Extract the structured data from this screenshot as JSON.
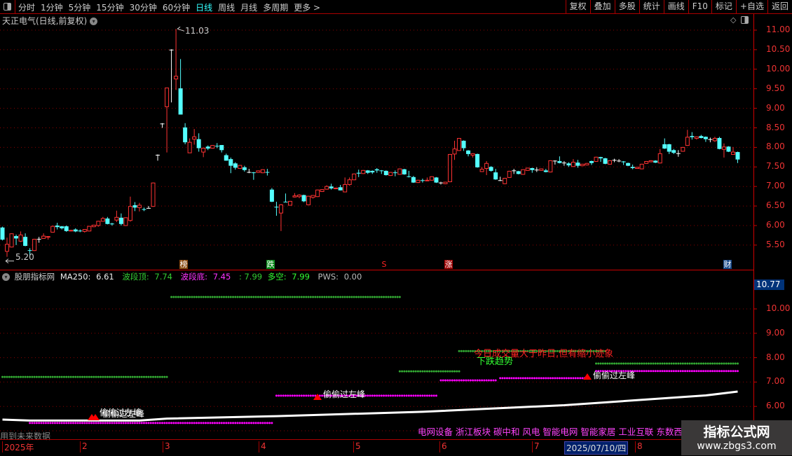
{
  "toolbar": {
    "periods": [
      "分时",
      "1分钟",
      "5分钟",
      "15分钟",
      "30分钟",
      "60分钟",
      "日线",
      "周线",
      "月线",
      "多周期",
      "更多 >"
    ],
    "active_period": "日线",
    "tools": [
      "复权",
      "叠加",
      "多股",
      "统计",
      "画线",
      "F10",
      "标记",
      "+自选",
      "返回"
    ]
  },
  "chart": {
    "title": "天正电气(日线,前复权)",
    "high_label": "11.03",
    "low_label": "5.20",
    "price_axis": [
      "11.00",
      "10.50",
      "10.00",
      "9.50",
      "9.00",
      "8.50",
      "8.00",
      "7.50",
      "7.00",
      "6.50",
      "6.00",
      "5.50"
    ],
    "colors": {
      "up": "#ff3333",
      "down": "#54ffff",
      "flat": "#ffffff",
      "grid": "#8b0000"
    },
    "tags": [
      {
        "text": "榜",
        "color": "#8a4a10"
      },
      {
        "text": "跌",
        "color": "#0a8a1a"
      },
      {
        "text": "S",
        "color": "#000000"
      },
      {
        "text": "涨",
        "color": "#a00000"
      },
      {
        "text": "财",
        "color": "#1a4a8a"
      }
    ],
    "candles": [
      [
        5.95,
        5.97,
        5.62,
        5.64
      ],
      [
        5.34,
        5.69,
        5.2,
        5.52
      ],
      [
        5.45,
        5.8,
        5.44,
        5.79
      ],
      [
        5.73,
        5.77,
        5.5,
        5.67
      ],
      [
        5.6,
        5.85,
        5.58,
        5.76
      ],
      [
        5.71,
        5.8,
        5.47,
        5.48
      ],
      [
        5.37,
        5.42,
        5.24,
        5.36
      ],
      [
        5.36,
        5.66,
        5.35,
        5.65
      ],
      [
        5.66,
        5.71,
        5.56,
        5.66
      ],
      [
        5.67,
        5.8,
        5.66,
        5.73
      ],
      [
        5.7,
        5.73,
        5.64,
        5.72
      ],
      [
        5.83,
        6.0,
        5.82,
        5.98
      ],
      [
        6.0,
        6.07,
        5.9,
        5.96
      ],
      [
        5.98,
        5.99,
        5.9,
        5.93
      ],
      [
        5.98,
        6.0,
        5.84,
        5.86
      ],
      [
        5.86,
        5.88,
        5.85,
        5.88
      ],
      [
        5.9,
        5.93,
        5.83,
        5.85
      ],
      [
        5.87,
        5.9,
        5.83,
        5.86
      ],
      [
        5.85,
        5.91,
        5.82,
        5.9
      ],
      [
        5.86,
        5.99,
        5.85,
        5.98
      ],
      [
        5.97,
        6.02,
        5.96,
        6.01
      ],
      [
        6.0,
        6.12,
        5.97,
        6.11
      ],
      [
        6.11,
        6.22,
        6.1,
        6.18
      ],
      [
        6.18,
        6.22,
        6.03,
        6.04
      ],
      [
        6.05,
        6.07,
        6.0,
        6.04
      ],
      [
        6.14,
        6.38,
        6.09,
        6.21
      ],
      [
        6.2,
        6.31,
        6.0,
        6.04
      ],
      [
        6.0,
        6.21,
        5.99,
        6.2
      ],
      [
        6.13,
        6.74,
        6.1,
        6.49
      ],
      [
        6.52,
        6.6,
        6.37,
        6.46
      ],
      [
        6.46,
        6.58,
        6.36,
        6.52
      ],
      [
        6.42,
        6.46,
        6.37,
        6.41
      ],
      [
        6.45,
        6.5,
        6.44,
        6.45
      ],
      [
        6.49,
        7.1,
        6.48,
        7.09
      ],
      [
        7.81,
        7.82,
        7.66,
        7.81
      ],
      [
        8.61,
        8.62,
        8.5,
        8.61
      ],
      [
        9.04,
        9.52,
        7.87,
        9.52
      ],
      [
        10.5,
        10.51,
        9.15,
        10.5
      ],
      [
        9.75,
        11.03,
        9.47,
        9.82
      ],
      [
        9.51,
        10.26,
        8.84,
        8.84
      ],
      [
        8.51,
        8.62,
        8.08,
        8.13
      ],
      [
        7.86,
        8.23,
        7.86,
        8.13
      ],
      [
        8.21,
        8.47,
        8.07,
        8.27
      ],
      [
        8.21,
        8.36,
        7.89,
        7.98
      ],
      [
        7.88,
        7.98,
        7.75,
        7.98
      ],
      [
        8.02,
        8.05,
        7.93,
        7.97
      ],
      [
        7.98,
        8.06,
        7.97,
        8.05
      ],
      [
        8.04,
        8.11,
        7.98,
        8.03
      ],
      [
        8.06,
        8.06,
        7.87,
        7.93
      ],
      [
        7.8,
        7.84,
        7.66,
        7.66
      ],
      [
        7.7,
        7.74,
        7.34,
        7.53
      ],
      [
        7.59,
        7.62,
        7.43,
        7.48
      ],
      [
        7.46,
        7.55,
        7.45,
        7.54
      ],
      [
        7.49,
        7.53,
        7.38,
        7.42
      ],
      [
        7.37,
        7.45,
        7.34,
        7.37
      ],
      [
        7.36,
        7.37,
        7.17,
        7.35
      ],
      [
        7.36,
        7.41,
        7.35,
        7.4
      ],
      [
        7.35,
        7.44,
        7.34,
        7.43
      ],
      [
        7.37,
        7.45,
        7.28,
        7.36
      ],
      [
        6.92,
        6.96,
        6.6,
        6.61
      ],
      [
        6.48,
        6.61,
        6.25,
        6.47
      ],
      [
        6.32,
        6.55,
        5.86,
        6.53
      ],
      [
        6.61,
        6.82,
        6.6,
        6.6
      ],
      [
        6.52,
        6.63,
        6.51,
        6.62
      ],
      [
        6.73,
        6.83,
        6.72,
        6.76
      ],
      [
        6.74,
        6.8,
        6.7,
        6.78
      ],
      [
        6.78,
        6.79,
        6.6,
        6.62
      ],
      [
        6.53,
        6.76,
        6.52,
        6.75
      ],
      [
        6.72,
        6.78,
        6.69,
        6.77
      ],
      [
        6.74,
        6.92,
        6.73,
        6.91
      ],
      [
        6.87,
        6.93,
        6.86,
        6.92
      ],
      [
        6.93,
        7.03,
        6.92,
        7.0
      ],
      [
        7.0,
        7.07,
        6.92,
        6.95
      ],
      [
        6.94,
        6.97,
        6.93,
        6.96
      ],
      [
        6.98,
        7.04,
        6.9,
        6.9
      ],
      [
        6.86,
        7.23,
        6.85,
        7.05
      ],
      [
        7.05,
        7.23,
        7.02,
        7.17
      ],
      [
        7.17,
        7.33,
        7.16,
        7.32
      ],
      [
        7.35,
        7.43,
        7.24,
        7.33
      ],
      [
        7.33,
        7.42,
        7.32,
        7.41
      ],
      [
        7.41,
        7.42,
        7.32,
        7.35
      ],
      [
        7.4,
        7.41,
        7.32,
        7.36
      ],
      [
        7.44,
        7.47,
        7.35,
        7.41
      ],
      [
        7.41,
        7.42,
        7.32,
        7.4
      ],
      [
        7.4,
        7.41,
        7.28,
        7.29
      ],
      [
        7.28,
        7.37,
        7.27,
        7.36
      ],
      [
        7.36,
        7.41,
        7.26,
        7.35
      ],
      [
        7.31,
        7.46,
        7.3,
        7.45
      ],
      [
        7.44,
        7.45,
        7.3,
        7.31
      ],
      [
        7.26,
        7.4,
        7.23,
        7.25
      ],
      [
        7.24,
        7.27,
        7.09,
        7.1
      ],
      [
        7.1,
        7.17,
        7.09,
        7.16
      ],
      [
        7.16,
        7.2,
        7.1,
        7.15
      ],
      [
        7.15,
        7.23,
        7.14,
        7.16
      ],
      [
        7.16,
        7.26,
        7.15,
        7.25
      ],
      [
        7.23,
        7.24,
        7.09,
        7.1
      ],
      [
        7.1,
        7.12,
        7.05,
        7.1
      ],
      [
        7.07,
        7.12,
        7.06,
        7.11
      ],
      [
        7.12,
        7.83,
        7.11,
        7.82
      ],
      [
        7.83,
        8.17,
        7.68,
        7.96
      ],
      [
        7.92,
        8.24,
        7.91,
        8.23
      ],
      [
        8.17,
        8.18,
        7.91,
        7.98
      ],
      [
        7.92,
        7.93,
        7.77,
        7.83
      ],
      [
        7.8,
        7.85,
        7.74,
        7.84
      ],
      [
        7.83,
        7.84,
        7.48,
        7.49
      ],
      [
        7.38,
        7.5,
        7.37,
        7.44
      ],
      [
        7.46,
        7.65,
        7.29,
        7.59
      ],
      [
        7.5,
        7.52,
        7.38,
        7.4
      ],
      [
        7.36,
        7.45,
        7.17,
        7.18
      ],
      [
        7.16,
        7.25,
        7.14,
        7.16
      ],
      [
        7.07,
        7.22,
        7.06,
        7.21
      ],
      [
        7.23,
        7.4,
        7.22,
        7.39
      ],
      [
        7.41,
        7.45,
        7.32,
        7.41
      ],
      [
        7.39,
        7.4,
        7.31,
        7.32
      ],
      [
        7.31,
        7.44,
        7.3,
        7.43
      ],
      [
        7.41,
        7.48,
        7.4,
        7.47
      ],
      [
        7.47,
        7.48,
        7.35,
        7.42
      ],
      [
        7.43,
        7.49,
        7.37,
        7.43
      ],
      [
        7.41,
        7.46,
        7.4,
        7.45
      ],
      [
        7.41,
        7.45,
        7.36,
        7.37
      ],
      [
        7.37,
        7.67,
        7.36,
        7.66
      ],
      [
        7.66,
        7.67,
        7.56,
        7.66
      ],
      [
        7.65,
        7.77,
        7.59,
        7.6
      ],
      [
        7.61,
        7.65,
        7.53,
        7.61
      ],
      [
        7.59,
        7.62,
        7.5,
        7.54
      ],
      [
        7.51,
        7.7,
        7.5,
        7.62
      ],
      [
        7.61,
        7.68,
        7.48,
        7.53
      ],
      [
        7.53,
        7.58,
        7.52,
        7.57
      ],
      [
        7.55,
        7.6,
        7.54,
        7.59
      ],
      [
        7.65,
        7.66,
        7.55,
        7.6
      ],
      [
        7.64,
        7.76,
        7.63,
        7.75
      ],
      [
        7.75,
        7.76,
        7.63,
        7.72
      ],
      [
        7.72,
        7.73,
        7.57,
        7.58
      ],
      [
        7.57,
        7.67,
        7.56,
        7.66
      ],
      [
        7.68,
        7.71,
        7.62,
        7.68
      ],
      [
        7.66,
        7.7,
        7.62,
        7.66
      ],
      [
        7.64,
        7.65,
        7.55,
        7.62
      ],
      [
        7.6,
        7.61,
        7.52,
        7.53
      ],
      [
        7.5,
        7.56,
        7.44,
        7.47
      ],
      [
        7.46,
        7.5,
        7.45,
        7.49
      ],
      [
        7.45,
        7.58,
        7.44,
        7.57
      ],
      [
        7.59,
        7.65,
        7.58,
        7.64
      ],
      [
        7.63,
        7.67,
        7.62,
        7.66
      ],
      [
        7.66,
        7.67,
        7.6,
        7.61
      ],
      [
        7.6,
        7.96,
        7.59,
        7.84
      ],
      [
        8.08,
        8.23,
        7.96,
        7.97
      ],
      [
        8.08,
        8.09,
        7.83,
        7.89
      ],
      [
        7.93,
        7.96,
        7.83,
        7.86
      ],
      [
        7.85,
        7.93,
        7.76,
        7.85
      ],
      [
        7.9,
        8.01,
        7.89,
        8.0
      ],
      [
        8.05,
        8.45,
        8.04,
        8.26
      ],
      [
        8.29,
        8.39,
        8.2,
        8.26
      ],
      [
        8.23,
        8.28,
        8.2,
        8.27
      ],
      [
        8.29,
        8.32,
        8.23,
        8.24
      ],
      [
        8.27,
        8.28,
        8.14,
        8.21
      ],
      [
        8.21,
        8.25,
        8.13,
        8.21
      ],
      [
        8.17,
        8.27,
        8.14,
        8.23
      ],
      [
        8.24,
        8.27,
        7.95,
        7.96
      ],
      [
        7.95,
        8.1,
        7.74,
        8.01
      ],
      [
        8.02,
        8.03,
        7.88,
        7.89
      ],
      [
        7.82,
        8.01,
        7.81,
        7.88
      ],
      [
        7.88,
        7.89,
        7.6,
        7.69
      ]
    ]
  },
  "indicator": {
    "name": "股朋指标网",
    "ma250_label": "MA250:",
    "ma250_value": "6.61",
    "top_label": "波段顶:",
    "top_value": "7.74",
    "bottom_label": "波段底:",
    "bottom_value": "7.45 ",
    "bottom_value2": ": 7.99",
    "longshort_label": "多空:",
    "longshort_value": "7.99",
    "pws_label": "PWS:",
    "pws_value": "0.00",
    "axis": [
      "10.00",
      "9.00",
      "8.00",
      "7.00",
      "6.00"
    ],
    "current_value": "10.77",
    "ma250_line": [
      [
        0,
        5.46
      ],
      [
        6,
        5.42
      ],
      [
        30,
        5.42
      ],
      [
        36,
        5.5
      ],
      [
        60,
        5.6
      ],
      [
        92,
        5.78
      ],
      [
        123,
        6.05
      ],
      [
        154,
        6.45
      ],
      [
        161,
        6.61
      ]
    ],
    "green_segments": [
      {
        "from": 0,
        "to": 36,
        "value": 7.21
      },
      {
        "from": 37,
        "to": 87,
        "value": 10.49
      },
      {
        "from": 87,
        "to": 100,
        "value": 7.44
      },
      {
        "from": 100,
        "to": 132,
        "value": 8.27
      },
      {
        "from": 130,
        "to": 161,
        "value": 7.76
      }
    ],
    "magenta_segments": [
      {
        "from": 6,
        "to": 59,
        "value": 5.32
      },
      {
        "from": 60,
        "to": 95,
        "value": 6.44
      },
      {
        "from": 96,
        "to": 108,
        "value": 7.07
      },
      {
        "from": 109,
        "to": 128,
        "value": 7.16
      },
      {
        "from": 130,
        "to": 161,
        "value": 7.45
      }
    ],
    "signal_text": "偷偷过左峰",
    "volume_note": "今日成交量大于昨日,但有缩小迹象",
    "trend_note": "下跌趋势",
    "sectors": "电网设备 浙江板块 碳中和 风电 智能电网 智能家居 工业互联 东数西算",
    "future_warning": "用到未来数据"
  },
  "date_axis": {
    "labels": [
      "2025年",
      "2",
      "3",
      "4",
      "5",
      "6",
      "7",
      "8"
    ],
    "selected": "2025/07/10/四"
  },
  "watermark": {
    "title": "指标公式网",
    "url": "www.zbgs3.com"
  }
}
